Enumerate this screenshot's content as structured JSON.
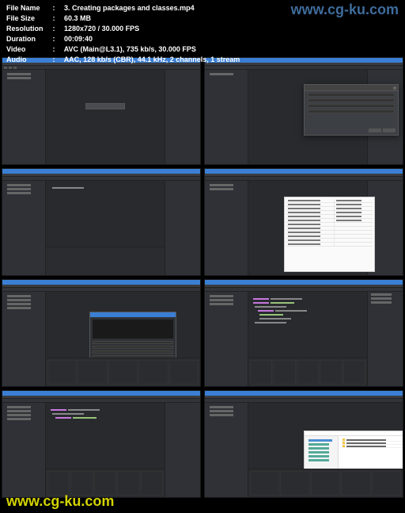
{
  "watermark_top": "www.cg-ku.com",
  "watermark_bottom": "www.cg-ku.com",
  "info": {
    "rows": [
      {
        "label": "File Name",
        "value": "3. Creating packages and classes.mp4"
      },
      {
        "label": "File Size",
        "value": "60.3 MB"
      },
      {
        "label": "Resolution",
        "value": "1280x720 / 30.000 FPS"
      },
      {
        "label": "Duration",
        "value": "00:09:40"
      },
      {
        "label": "Video",
        "value": "AVC (Main@L3.1), 735 kb/s, 30.000 FPS"
      },
      {
        "label": "Audio",
        "value": "AAC, 128 kb/s (CBR), 44.1 kHz, 2 channels, 1 stream"
      }
    ],
    "separator": ":"
  }
}
